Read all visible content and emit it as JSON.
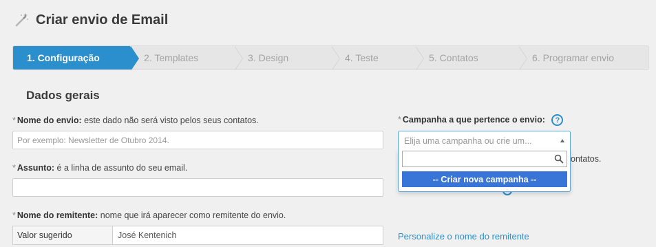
{
  "header": {
    "title": "Criar envio de Email",
    "icon": "magic-wand-icon"
  },
  "wizard": {
    "steps": [
      {
        "label": "1. Configuração",
        "active": true
      },
      {
        "label": "2. Templates",
        "active": false
      },
      {
        "label": "3. Design",
        "active": false
      },
      {
        "label": "4. Teste",
        "active": false
      },
      {
        "label": "5. Contatos",
        "active": false
      },
      {
        "label": "6. Programar envio",
        "active": false
      }
    ],
    "active_color": "#2a8fcc"
  },
  "section": {
    "title": "Dados gerais"
  },
  "nome_envio": {
    "required_mark": "*",
    "label": "Nome do envio:",
    "hint": "este dado não será visto pelos seus contatos.",
    "placeholder": "Por exemplo: Newsletter de Otubro 2014.",
    "value": ""
  },
  "assunto": {
    "required_mark": "*",
    "label": "Assunto:",
    "hint": "é a linha de assunto do seu email.",
    "value": ""
  },
  "remetente": {
    "required_mark": "*",
    "label": "Nome do remitente:",
    "hint": "nome que irá aparecer como remitente do envio.",
    "prefix_label": "Valor sugerido",
    "value": "José Kentenich"
  },
  "campanha": {
    "required_mark": "*",
    "label": "Campanha a que pertence o envio:",
    "help_icon": "?",
    "placeholder": "Elija uma campanha ou crie um...",
    "search_value": "",
    "options": [
      "-- Criar nova campanha --"
    ],
    "behind_text": "ontatos."
  },
  "personalize_link": "Personalize o nome do remitente"
}
